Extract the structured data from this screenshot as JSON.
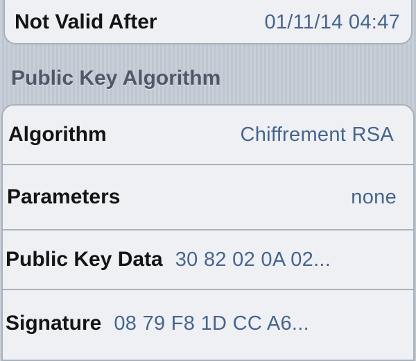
{
  "validity": {
    "not_valid_after": {
      "label": "Not Valid After",
      "value": "01/11/14 04:47"
    }
  },
  "public_key_section": {
    "header": "Public Key Algorithm",
    "rows": [
      {
        "label": "Algorithm",
        "value": "Chiffrement RSA"
      },
      {
        "label": "Parameters",
        "value": "none"
      },
      {
        "label": "Public Key Data",
        "value": "30 82 02 0A 02..."
      },
      {
        "label": "Signature",
        "value": "08 79 F8 1D CC A6..."
      }
    ]
  },
  "colors": {
    "background": "#c5ccd6",
    "cell_background": "#eef0f3",
    "label_text": "#141414",
    "value_text": "#47648e",
    "header_text": "#4f5868"
  }
}
